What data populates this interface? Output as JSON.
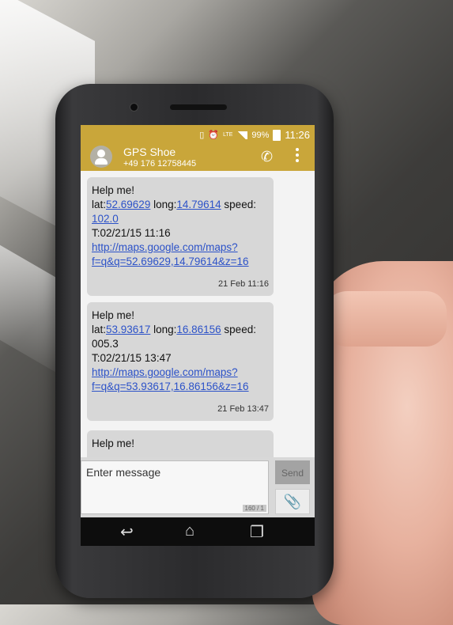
{
  "status_bar": {
    "battery": "99%",
    "time": "11:26",
    "network": "LTE"
  },
  "conversation": {
    "contact_name": "GPS Shoe",
    "contact_number": "+49 176 12758445",
    "icons": {
      "call": "phone-icon",
      "menu": "overflow-menu-icon"
    }
  },
  "messages": [
    {
      "line1": "Help me!",
      "lat_label": "lat:",
      "lat": "52.69629",
      "long_label": " long:",
      "long": "14.79614",
      "speed_label": " speed:",
      "speed": "102.0",
      "time_line": "T:02/21/15 11:16",
      "url_line1": "http://maps.google.com/maps?",
      "url_line2": "f=q&q=52.69629,14.79614&z=16",
      "timestamp": "21 Feb 11:16"
    },
    {
      "line1": "Help me!",
      "lat_label": "lat:",
      "lat": "53.93617",
      "long_label": " long:",
      "long": "16.86156",
      "speed_label": " speed:",
      "speed_plain": "005.3",
      "time_line": "T:02/21/15 13:47",
      "url_line1": "http://maps.google.com/maps?",
      "url_line2": "f=q&q=53.93617,16.86156&z=16",
      "timestamp": "21 Feb 13:47"
    },
    {
      "line1": "Help me!"
    }
  ],
  "composer": {
    "placeholder": "Enter message",
    "counter": "160 / 1",
    "send_label": "Send"
  }
}
